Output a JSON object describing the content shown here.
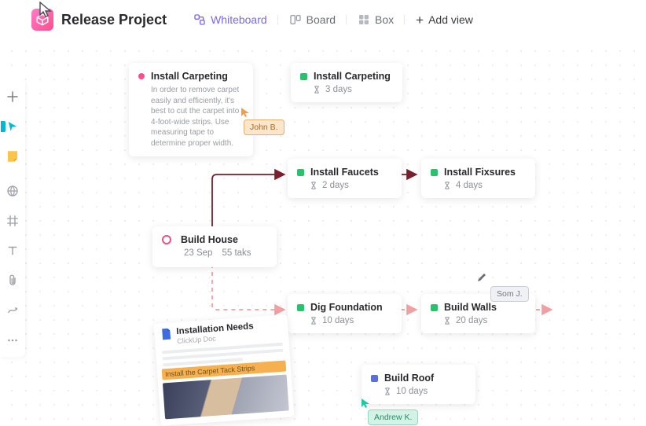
{
  "header": {
    "title": "Release Project"
  },
  "views": {
    "whiteboard": "Whiteboard",
    "board": "Board",
    "box": "Box",
    "add": "Add view"
  },
  "colors": {
    "accent": "#7B68EE",
    "pink": "#FF4D8D",
    "green": "#27C26B",
    "connector_dark": "#7A1F2C",
    "connector_light": "#EF9090"
  },
  "cards": {
    "carpet_desc": {
      "title": "Install Carpeting",
      "desc": "In order to remove carpet easily and efficiently, it's best to cut the carpet into 4-foot-wide strips. Use measuring tape to determine proper width.",
      "status_color": "#FF4D8D"
    },
    "carpet_small": {
      "title": "Install Carpeting",
      "duration": "3 days",
      "status_color": "#27C26B"
    },
    "faucets": {
      "title": "Install Faucets",
      "duration": "2 days",
      "status_color": "#27C26B"
    },
    "fixtures": {
      "title": "Install Fixsures",
      "duration": "4 days",
      "status_color": "#27C26B"
    },
    "build_house": {
      "title": "Build House",
      "date": "23 Sep",
      "tasks": "55 taks"
    },
    "dig": {
      "title": "Dig Foundation",
      "duration": "10 days",
      "status_color": "#27C26B"
    },
    "walls": {
      "title": "Build Walls",
      "duration": "20 days",
      "status_color": "#27C26B"
    },
    "roof": {
      "title": "Build Roof",
      "duration": "10 days",
      "status_color": "#5B6FDB"
    }
  },
  "people": {
    "john": "John B.",
    "sam": "Som J.",
    "andrew": "Andrew K."
  },
  "doc": {
    "title": "Installation Needs",
    "subtitle": "ClickUp Doc",
    "bar": "Install the Carpet Tack Strips"
  }
}
